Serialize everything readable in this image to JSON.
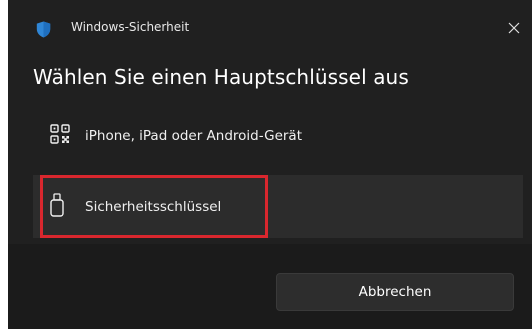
{
  "window": {
    "title": "Windows-Sicherheit",
    "close_icon": "close-icon",
    "app_icon": "shield-icon"
  },
  "dialog": {
    "heading": "Wählen Sie einen Hauptschlüssel aus",
    "options": [
      {
        "label": "iPhone, iPad oder Android-Gerät",
        "icon": "qr-code-icon",
        "selected": false
      },
      {
        "label": "Sicherheitsschlüssel",
        "icon": "usb-key-icon",
        "selected": true
      }
    ],
    "cancel_label": "Abbrechen"
  },
  "colors": {
    "background": "#202020",
    "footer": "#1b1b1b",
    "selected_option": "#2c2c2c",
    "highlight": "#d9272e",
    "shield": "#2f86d6"
  }
}
